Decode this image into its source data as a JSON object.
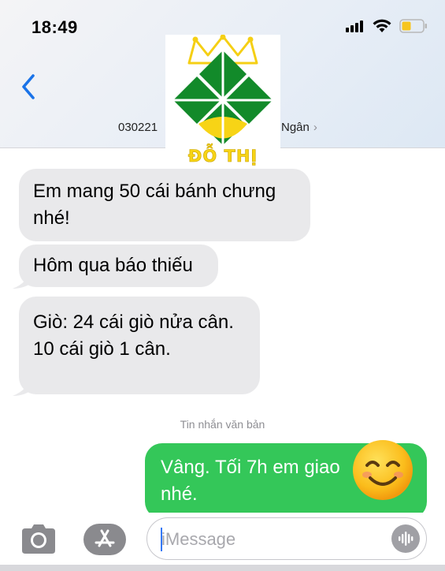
{
  "status_bar": {
    "time": "18:49",
    "icons": [
      "cellular-signal-icon",
      "wifi-icon",
      "battery-low-icon"
    ],
    "battery_color": "#f7c51e"
  },
  "header": {
    "back_icon": "chevron-left-icon",
    "contact_partial_left": "030221",
    "contact_partial_right": "Ngân",
    "contact_chevron": "›"
  },
  "watermark": {
    "brand_text": "ĐỖ THỊ",
    "colors": {
      "green": "#128a2a",
      "yellow": "#f7d416",
      "crown": "#f5cf14"
    }
  },
  "messages": {
    "incoming": [
      {
        "lines": [
          "Em mang 50 cái bánh chưng",
          "nhé!"
        ]
      },
      {
        "lines": [
          "Hôm qua báo thiếu"
        ]
      },
      {
        "lines": [
          "Giò: 24 cái giò nửa cân.",
          "10 cái giò 1 cân."
        ]
      }
    ],
    "system_label": "Tin nhắn văn bản",
    "outgoing": [
      {
        "lines": [
          "Vâng. Tối 7h em giao",
          "nhé."
        ]
      }
    ]
  },
  "composer": {
    "placeholder": "iMessage",
    "camera_icon": "camera-icon",
    "apps_icon": "app-store-icon",
    "voice_icon": "waveform-icon"
  },
  "colors": {
    "incoming_bubble": "#e9e9eb",
    "outgoing_bubble": "#34c759",
    "accent_blue": "#1a73e8"
  }
}
